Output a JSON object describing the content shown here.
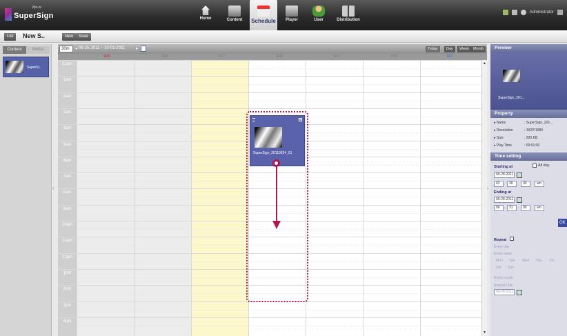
{
  "app": {
    "logo": "SuperSign",
    "logo_sub": "Bio-w"
  },
  "nav": [
    {
      "label": "Home",
      "icon": "home-icon"
    },
    {
      "label": "Content",
      "icon": "content-icon"
    },
    {
      "label": "Schedule",
      "icon": "schedule-icon"
    },
    {
      "label": "Player",
      "icon": "player-icon"
    },
    {
      "label": "User",
      "icon": "user-icon"
    },
    {
      "label": "Distribution",
      "icon": "distribution-icon"
    }
  ],
  "topright": {
    "user": "Administrator"
  },
  "toolbar": {
    "list_label": "List",
    "title": "New S..",
    "new_label": "New",
    "save_label": "Save"
  },
  "left": {
    "tabs": [
      "Content",
      "Media"
    ],
    "item_label": "SuperSi.."
  },
  "calendar": {
    "interval": "30m",
    "range": "09-25-2011 ~ 10-01-2011",
    "views": [
      "Today",
      "Day",
      "Week",
      "Month"
    ],
    "days": [
      "9/25",
      "9/26",
      "9/27",
      "9/28",
      "9/29",
      "9/30",
      "10/1"
    ],
    "hours": [
      "12am",
      "1am",
      "2am",
      "3am",
      "4am",
      "5am",
      "6am",
      "7am",
      "8am",
      "9am",
      "10am",
      "11am",
      "12pm",
      "1pm",
      "2pm",
      "3pm",
      "4pm"
    ],
    "event": {
      "label": "SuperSign_20110924_01"
    }
  },
  "right": {
    "preview_title": "Preview",
    "preview_name": "SuperSign_201...",
    "property_title": "Property",
    "properties": [
      {
        "k": "Name",
        "v": "SuperSign_201..."
      },
      {
        "k": "Resolution",
        "v": "1920*1080"
      },
      {
        "k": "Size",
        "v": "205 KB"
      },
      {
        "k": "Play Time",
        "v": "00:01:00"
      }
    ],
    "time_title": "Time setting",
    "start_label": "Starting at",
    "allday_label": "All day",
    "start_date": "09-28-2011",
    "start_h": "03",
    "start_m": "30",
    "start_s": "00",
    "start_ampm": "am",
    "end_label": "Ending at",
    "end_date": "09-28-2011",
    "end_h": "06",
    "end_m": "31",
    "end_s": "00",
    "end_ampm": "am",
    "ok_label": "OK",
    "repeat_label": "Repeat",
    "every_day": "Every day",
    "every_week": "Every week",
    "weekdays": [
      "Mon",
      "Tue",
      "Wed",
      "Thu",
      "Fri",
      "Sat",
      "Sun"
    ],
    "every_month": "Every month",
    "repeat_until": "Repeat Until",
    "until_date": "09-28-2011"
  }
}
